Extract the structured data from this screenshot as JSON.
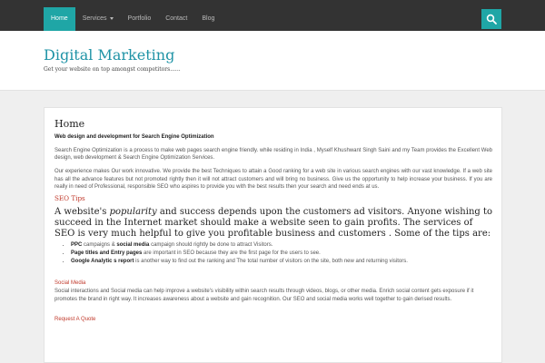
{
  "nav": {
    "items": [
      {
        "label": "Home"
      },
      {
        "label": "Services"
      },
      {
        "label": "Portfolio"
      },
      {
        "label": "Contact"
      },
      {
        "label": "Blog"
      }
    ]
  },
  "icons": {
    "search": "search-icon",
    "services_caret": "chevron-down-icon"
  },
  "colors": {
    "accent": "#1fa6a6",
    "topbar": "#333333",
    "link_red": "#c0392b",
    "title_teal": "#1f93a6"
  },
  "header": {
    "site_title": "Digital Marketing",
    "tagline": "Get your website on top amongst competitors......"
  },
  "main": {
    "page_title": "Home",
    "subheading": "Web design and development for Search Engine Optimization",
    "para1": "Search Engine Optimization is a process to make  web pages search engine friendly.  while residing in India , Myself  Khushwant Singh Saini and my Team provides the Excellent Web design, web development & Search Engine Optimization Services.",
    "para2": "Our experience makes Our work innovative. We provide the best Techniques to attain a Good ranking for a web site in various search engines with our vast knowledge. If a web site has all the advance features but not promoted rightly then it will not attract customers and will bring  no business. Give us the opportunity to help increase your business. If you are really in need of Professional, responsible SEO who aspires to provide you with the best results then your search and need ends at us.",
    "seo_tips_heading": "SEO Tips",
    "big": {
      "prefix": "A website's ",
      "emphasis": "popularity",
      "suffix": "  and success depends  upon the customers ad visitors. Anyone wishing to succeed in the Internet market should make a website seen to gain profits. The services of  SEO is very much helpful to give you profitable  business and customers . Some of the tips are:"
    },
    "tips": [
      {
        "bold": "PPC",
        "text": " campaigns & ",
        "bold2": "social media",
        "text2": " campaign should rightly be done to attract Visitors."
      },
      {
        "bold": "Page titles and Entry pages",
        "text": " are important in SEO because they are the first page for the users to see.",
        "bold2": "",
        "text2": ""
      },
      {
        "bold": "Google Analytic s report",
        "text": " is another way to find out the ranking and The total number of visitors on the site, both new and returning visitors.",
        "bold2": "",
        "text2": ""
      }
    ],
    "social_media_title": "Social Media",
    "social_media_text": "Social interactions and Social media can help improve a website's visibility within search results through videos, blogs, or other media. Enrich social content gets exposure if it promotes the brand in right way. It increases awareness about a website and gain recognition. Our SEO and social media works well together to gain derised results.",
    "request_quote": "Request A Quote"
  }
}
